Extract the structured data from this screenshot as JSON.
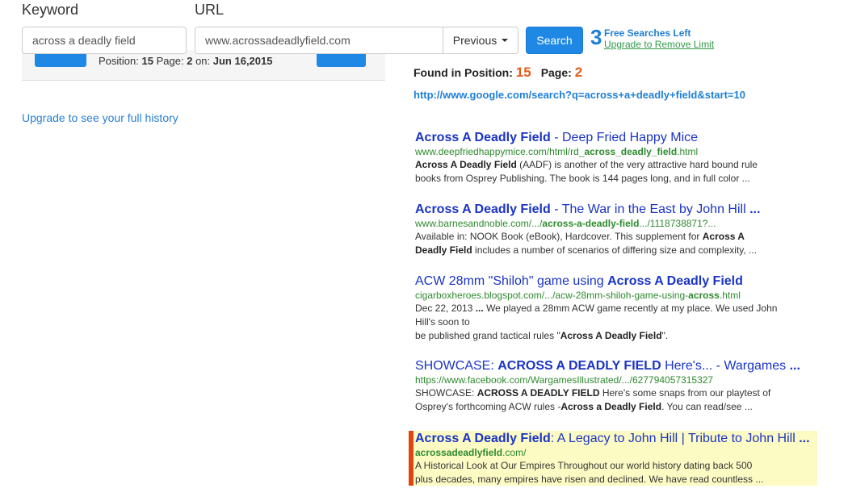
{
  "form": {
    "keyword_label": "Keyword",
    "url_label": "URL",
    "keyword_value": "across a deadly field",
    "url_value": "www.acrossadeadlyfield.com",
    "previous_label": "Previous",
    "search_label": "Search",
    "free_count": "3",
    "free_label": "Free Searches Left",
    "upgrade_limit": "Upgrade to Remove Limit"
  },
  "history": {
    "position_label": "Position:",
    "position": "15",
    "page_label": "Page:",
    "page": "2",
    "on_label": "on:",
    "date": "Jun 16,2015",
    "upgrade_link": "Upgrade to see your full history"
  },
  "found": {
    "label": "Found in Position:",
    "position": "15",
    "page_label": "Page:",
    "page": "2",
    "google_url": "http://www.google.com/search?q=across+a+deadly+field&start=10"
  },
  "results": [
    {
      "title_bold": "Across A Deadly Field",
      "title_rest": " - Deep Fried Happy Mice",
      "url_pre": "www.deepfriedhappymice.com/html/rd_",
      "url_bold": "across_deadly_field",
      "url_post": ".html",
      "snip_bold1": "Across A Deadly Field",
      "snip_text1": " (AADF) is another of the very attractive hard bound rule",
      "snip_text2": "books from Osprey Publishing. The book is 144 pages long, and in full color ..."
    },
    {
      "title_bold": "Across A Deadly Field",
      "title_rest": " - The War in the East by John Hill ",
      "title_ellipsis": "...",
      "url_pre": "www.barnesandnoble.com/.../",
      "url_bold": "across-a-deadly-field",
      "url_post": ".../1118738871?...",
      "snip_text1": "Available in: NOOK Book (eBook), Hardcover. This supplement for ",
      "snip_bold1": "Across A",
      "snip_bold2": "Deadly Field",
      "snip_text2": " includes a number of scenarios of differing size and complexity, ..."
    },
    {
      "title_rest": "ACW 28mm \"Shiloh\" game using ",
      "title_bold": "Across A Deadly Field",
      "url_pre": "cigarboxheroes.blogspot.com/.../acw-28mm-shiloh-game-using-",
      "url_bold": "across",
      "url_post": ".html",
      "snip_text1": "Dec 22, 2013 ",
      "snip_bold1": "...",
      "snip_text2": " We played a 28mm ACW game recently at my place. We used John",
      "snip_text3": "Hill's soon to",
      "snip_text4": "be published grand tactical rules \"",
      "snip_bold2": "Across A Deadly Field",
      "snip_text5": "\"."
    },
    {
      "title_pre": "SHOWCASE: ",
      "title_bold": "ACROSS A DEADLY FIELD",
      "title_rest": " Here's... - Wargames ",
      "title_ellipsis": "...",
      "url_pre": "https://www.facebook.com/WargamesIllustrated/.../627794057315327",
      "snip_text1": "SHOWCASE: ",
      "snip_bold1": "ACROSS A DEADLY FIELD",
      "snip_text2": " Here's some snaps from our playtest of",
      "snip_text3": "Osprey's forthcoming ACW rules -",
      "snip_bold2": "Across a Deadly Field",
      "snip_text4": ". You can read/see ..."
    },
    {
      "title_bold": "Across A Deadly Field",
      "title_rest": ": A Legacy to John Hill | Tribute to John Hill ",
      "title_ellipsis": "...",
      "url_bold": "acrossadeadlyfield",
      "url_post": ".com/",
      "snip_text1": "A Historical Look at Our Empires Throughout our world history dating back 500",
      "snip_text2": "plus decades, many empires have risen and declined. We have read countless ..."
    }
  ],
  "colors": {
    "link_blue": "#1a34c4",
    "url_green": "#2e8a2e",
    "accent_orange": "#e8591a",
    "highlight_yellow": "#fdfbc4",
    "button_blue": "#1f88e5"
  }
}
